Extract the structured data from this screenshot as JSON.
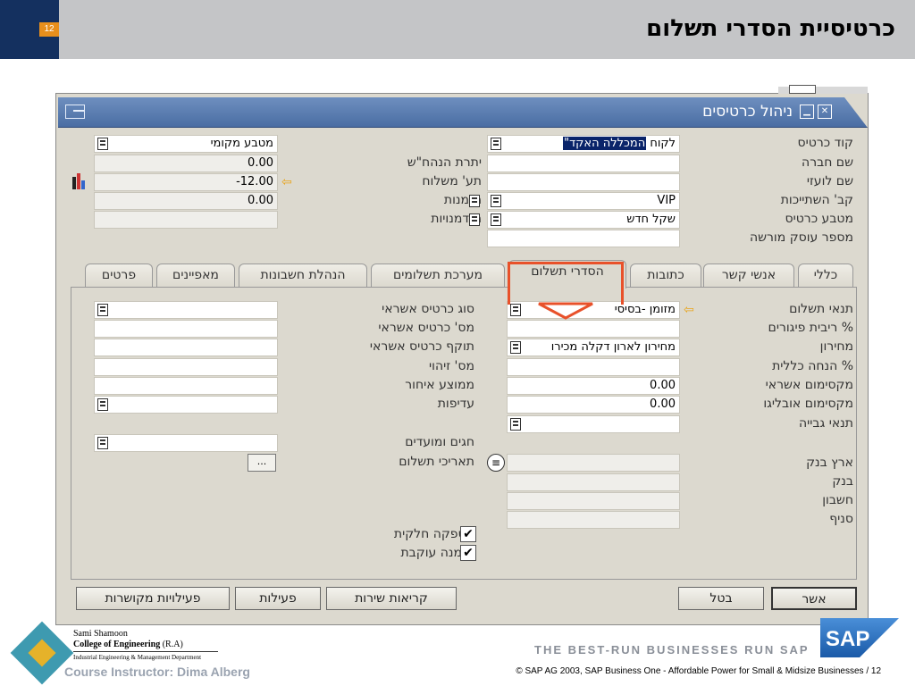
{
  "slide": {
    "number": "12",
    "title": "כרטיסיית הסדרי תשלום"
  },
  "window": {
    "title": "ניהול כרטיסים"
  },
  "header_right": {
    "fields": [
      {
        "label": "קוד כרטיס",
        "value_prefix": "המכללה האקד\"",
        "value_suffix": "לקוח"
      },
      {
        "label": "שם חברה",
        "value": ""
      },
      {
        "label": "שם לועזי",
        "value": ""
      },
      {
        "label": "קב' השתייכות",
        "value": "VIP"
      },
      {
        "label": "מטבע כרטיס",
        "value": "שקל חדש"
      },
      {
        "label": "מספר עוסק מורשה",
        "value": ""
      }
    ]
  },
  "header_left": {
    "currency": "מטבע מקומי",
    "fields": [
      {
        "label": "יתרת הנהח\"ש",
        "value": "0.00"
      },
      {
        "label": "תע' משלוח",
        "value": "-12.00"
      },
      {
        "label": "הזמנות",
        "value": "0.00"
      },
      {
        "label": "הזדמנויות",
        "value": ""
      }
    ]
  },
  "tabs": [
    {
      "label": "כללי"
    },
    {
      "label": "אנשי קשר"
    },
    {
      "label": "כתובות"
    },
    {
      "label": "הסדרי תשלום"
    },
    {
      "label": "מערכת תשלומים"
    },
    {
      "label": "הנהלת חשבונות"
    },
    {
      "label": "מאפיינים"
    },
    {
      "label": "פרטים"
    }
  ],
  "payment_right": {
    "fields": [
      {
        "label": "תנאי תשלום",
        "value": "מזומן -בסיסי"
      },
      {
        "label": "% ריבית פיגורים",
        "value": ""
      },
      {
        "label": "מחירון",
        "value": "מחירון לארון דקלה מכירו"
      },
      {
        "label": "% הנחה כללית",
        "value": ""
      },
      {
        "label": "מקסימום אשראי",
        "value": "0.00"
      },
      {
        "label": "מקסימום אובליגו",
        "value": "0.00"
      },
      {
        "label": "תנאי גבייה",
        "value": ""
      }
    ],
    "bank_fields": [
      {
        "label": "ארץ בנק",
        "value": ""
      },
      {
        "label": "בנק",
        "value": ""
      },
      {
        "label": "חשבון",
        "value": ""
      },
      {
        "label": "סניף",
        "value": ""
      }
    ]
  },
  "payment_left": {
    "fields": [
      {
        "label": "סוג כרטיס אשראי",
        "value": ""
      },
      {
        "label": "מס' כרטיס אשראי",
        "value": ""
      },
      {
        "label": "תוקף כרטיס אשראי",
        "value": ""
      },
      {
        "label": "מס' זיהוי",
        "value": ""
      },
      {
        "label": "ממוצע איחור",
        "value": ""
      },
      {
        "label": "עדיפות",
        "value": ""
      }
    ],
    "holidays_label": "חגים ומועדים",
    "payment_dates_label": "תאריכי תשלום",
    "dots_label": "...",
    "checkboxes": [
      {
        "label": "אספקה חלקית",
        "checked": true
      },
      {
        "label": "הזמנה עוקבת",
        "checked": true
      }
    ]
  },
  "buttons": {
    "ok": "אשר",
    "cancel": "בטל",
    "service_calls": "קריאות שירות",
    "activities": "פעילות",
    "related_activities": "פעילויות מקושרות"
  },
  "footer": {
    "name": "Sami Shamoon",
    "college": "College of Engineering",
    "college_suffix": "(R.A)",
    "department": "Industrial Engineering & Management Department",
    "instructor": "Course Instructor: Dima Alberg",
    "tagline": "THE BEST-RUN BUSINESSES RUN SAP",
    "copyright": "©  SAP AG 2003, SAP Business One - Affordable Power for Small & Midsize Businesses / 12",
    "sap_logo_text": "SAP"
  },
  "colors": {
    "header_bg": "#c4c5c7",
    "slide_number_bg": "#14305f",
    "slide_number_badge": "#e88f1c",
    "titlebar": "#4a6da3",
    "window_bg": "#dcd9cf",
    "highlight_frame": "#e8512a",
    "selection": "#0a246a"
  }
}
